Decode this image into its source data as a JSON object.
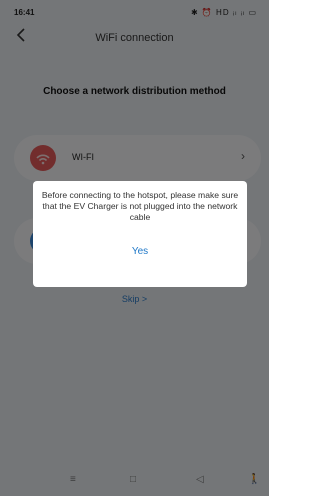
{
  "status_bar": {
    "time": "16:41",
    "icons": "✱ ⏰ HD ᵢₗ ᵢₗ ▭"
  },
  "header": {
    "back_icon": "chevron-left",
    "title": "WiFi connection"
  },
  "main": {
    "subtitle": "Choose a network distribution method",
    "options": [
      {
        "label": "WI-FI",
        "icon": "wifi-icon",
        "color": "#e45a5a"
      },
      {
        "label": "",
        "icon": "hotspot-icon",
        "color": "#3a88d6"
      }
    ],
    "skip_label": "Skip  >"
  },
  "dialog": {
    "message": "Before connecting to the hotspot, please make sure that the EV Charger is not plugged into the network cable",
    "confirm_label": "Yes"
  },
  "navbar": {
    "items": [
      "≡",
      "□",
      "◁",
      "🚶"
    ]
  }
}
